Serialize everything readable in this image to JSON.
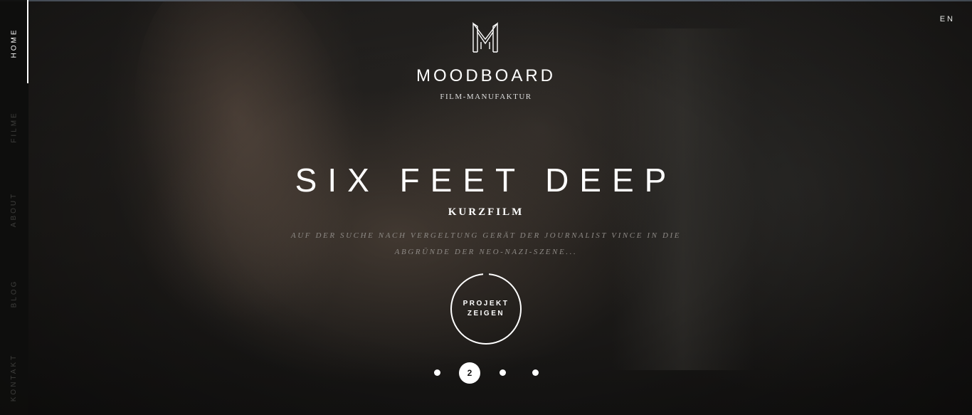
{
  "nav": {
    "items": [
      {
        "label": "HOME",
        "active": true
      },
      {
        "label": "FILME",
        "active": false
      },
      {
        "label": "ABOUT",
        "active": false
      },
      {
        "label": "BLOG",
        "active": false
      },
      {
        "label": "KONTAKT",
        "active": false
      }
    ]
  },
  "language": "EN",
  "brand": {
    "logo_icon": "moodboard-m-logo",
    "name": "MOODBOARD",
    "tagline": "FILM-MANUFAKTUR"
  },
  "hero": {
    "title": "SIX FEET DEEP",
    "category": "KURZFILM",
    "description": "AUF DER SUCHE NACH VERGELTUNG GERÄT DER JOURNALIST VINCE IN DIE ABGRÜNDE DER NEO-NAZI-SZENE...",
    "cta_line1": "PROJEKT",
    "cta_line2": "ZEIGEN"
  },
  "pager": {
    "current": "2",
    "total": 4,
    "current_index": 2
  },
  "colors": {
    "sidebar_bg": "#0e0e0d",
    "accent": "#ffffff",
    "inactive_nav": "#3f3f3d",
    "description_text": "#8d8985"
  }
}
